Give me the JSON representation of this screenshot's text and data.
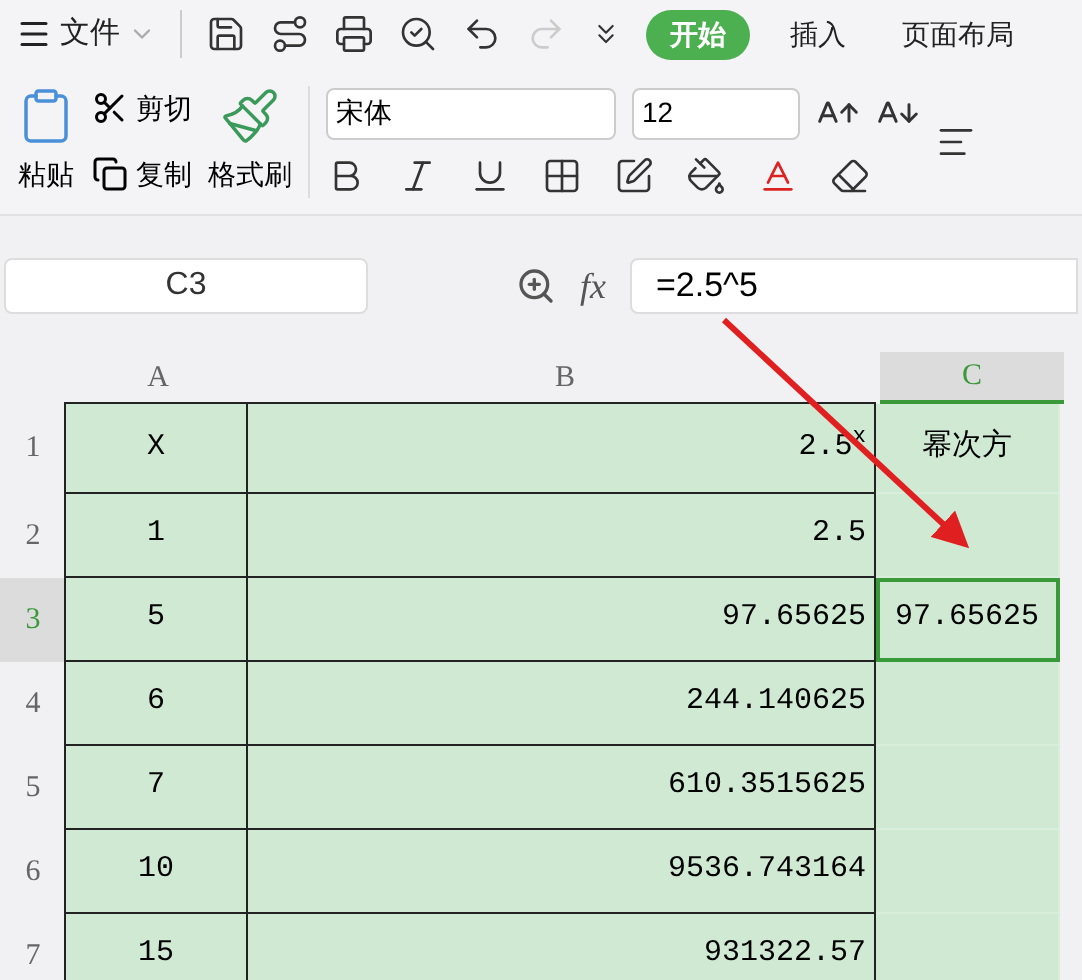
{
  "menu_bar": {
    "file_menu": "文件",
    "tabs": [
      {
        "label": "开始",
        "selected": true
      },
      {
        "label": "插入",
        "selected": false
      },
      {
        "label": "页面布局",
        "selected": false
      }
    ]
  },
  "ribbon": {
    "paste": "粘贴",
    "cut": "剪切",
    "copy": "复制",
    "format_painter": "格式刷",
    "font": "宋体",
    "font_size": "12"
  },
  "formula_bar": {
    "name_box": "C3",
    "fx": "fx",
    "formula": "=2.5^5"
  },
  "sheet": {
    "columns": [
      {
        "label": "A",
        "selected": false
      },
      {
        "label": "B",
        "selected": false
      },
      {
        "label": "C",
        "selected": true
      }
    ],
    "rows": [
      {
        "number": "1",
        "selected": false,
        "cells": [
          {
            "text": "X",
            "selected": false
          },
          {
            "text": "2.5$^{x}$",
            "selected": false
          },
          {
            "text": "幂次方",
            "selected": false
          }
        ]
      },
      {
        "number": "2",
        "selected": false,
        "cells": [
          {
            "text": "1",
            "selected": false
          },
          {
            "text": "2.5",
            "selected": false
          },
          {
            "selected": false
          }
        ]
      },
      {
        "number": "3",
        "selected": true,
        "cells": [
          {
            "text": "5",
            "selected": false
          },
          {
            "text": "97.65625",
            "selected": false
          },
          {
            "text": "97.65625",
            "selected": true
          }
        ]
      },
      {
        "number": "4",
        "selected": false,
        "cells": [
          {
            "text": "6",
            "selected": false
          },
          {
            "text": "244.140625",
            "selected": false
          },
          {
            "selected": false
          }
        ]
      },
      {
        "number": "5",
        "selected": false,
        "cells": [
          {
            "text": "7",
            "selected": false
          },
          {
            "text": "610.3515625",
            "selected": false
          },
          {
            "selected": false
          }
        ]
      },
      {
        "number": "6",
        "selected": false,
        "cells": [
          {
            "text": "10",
            "selected": false
          },
          {
            "text": "9536.743164",
            "selected": false
          },
          {
            "selected": false
          }
        ]
      },
      {
        "number": "7",
        "selected": false,
        "cells": [
          {
            "text": "15",
            "selected": false
          },
          {
            "text": "931322.57",
            "selected": false
          },
          {
            "selected": false
          }
        ]
      }
    ]
  }
}
